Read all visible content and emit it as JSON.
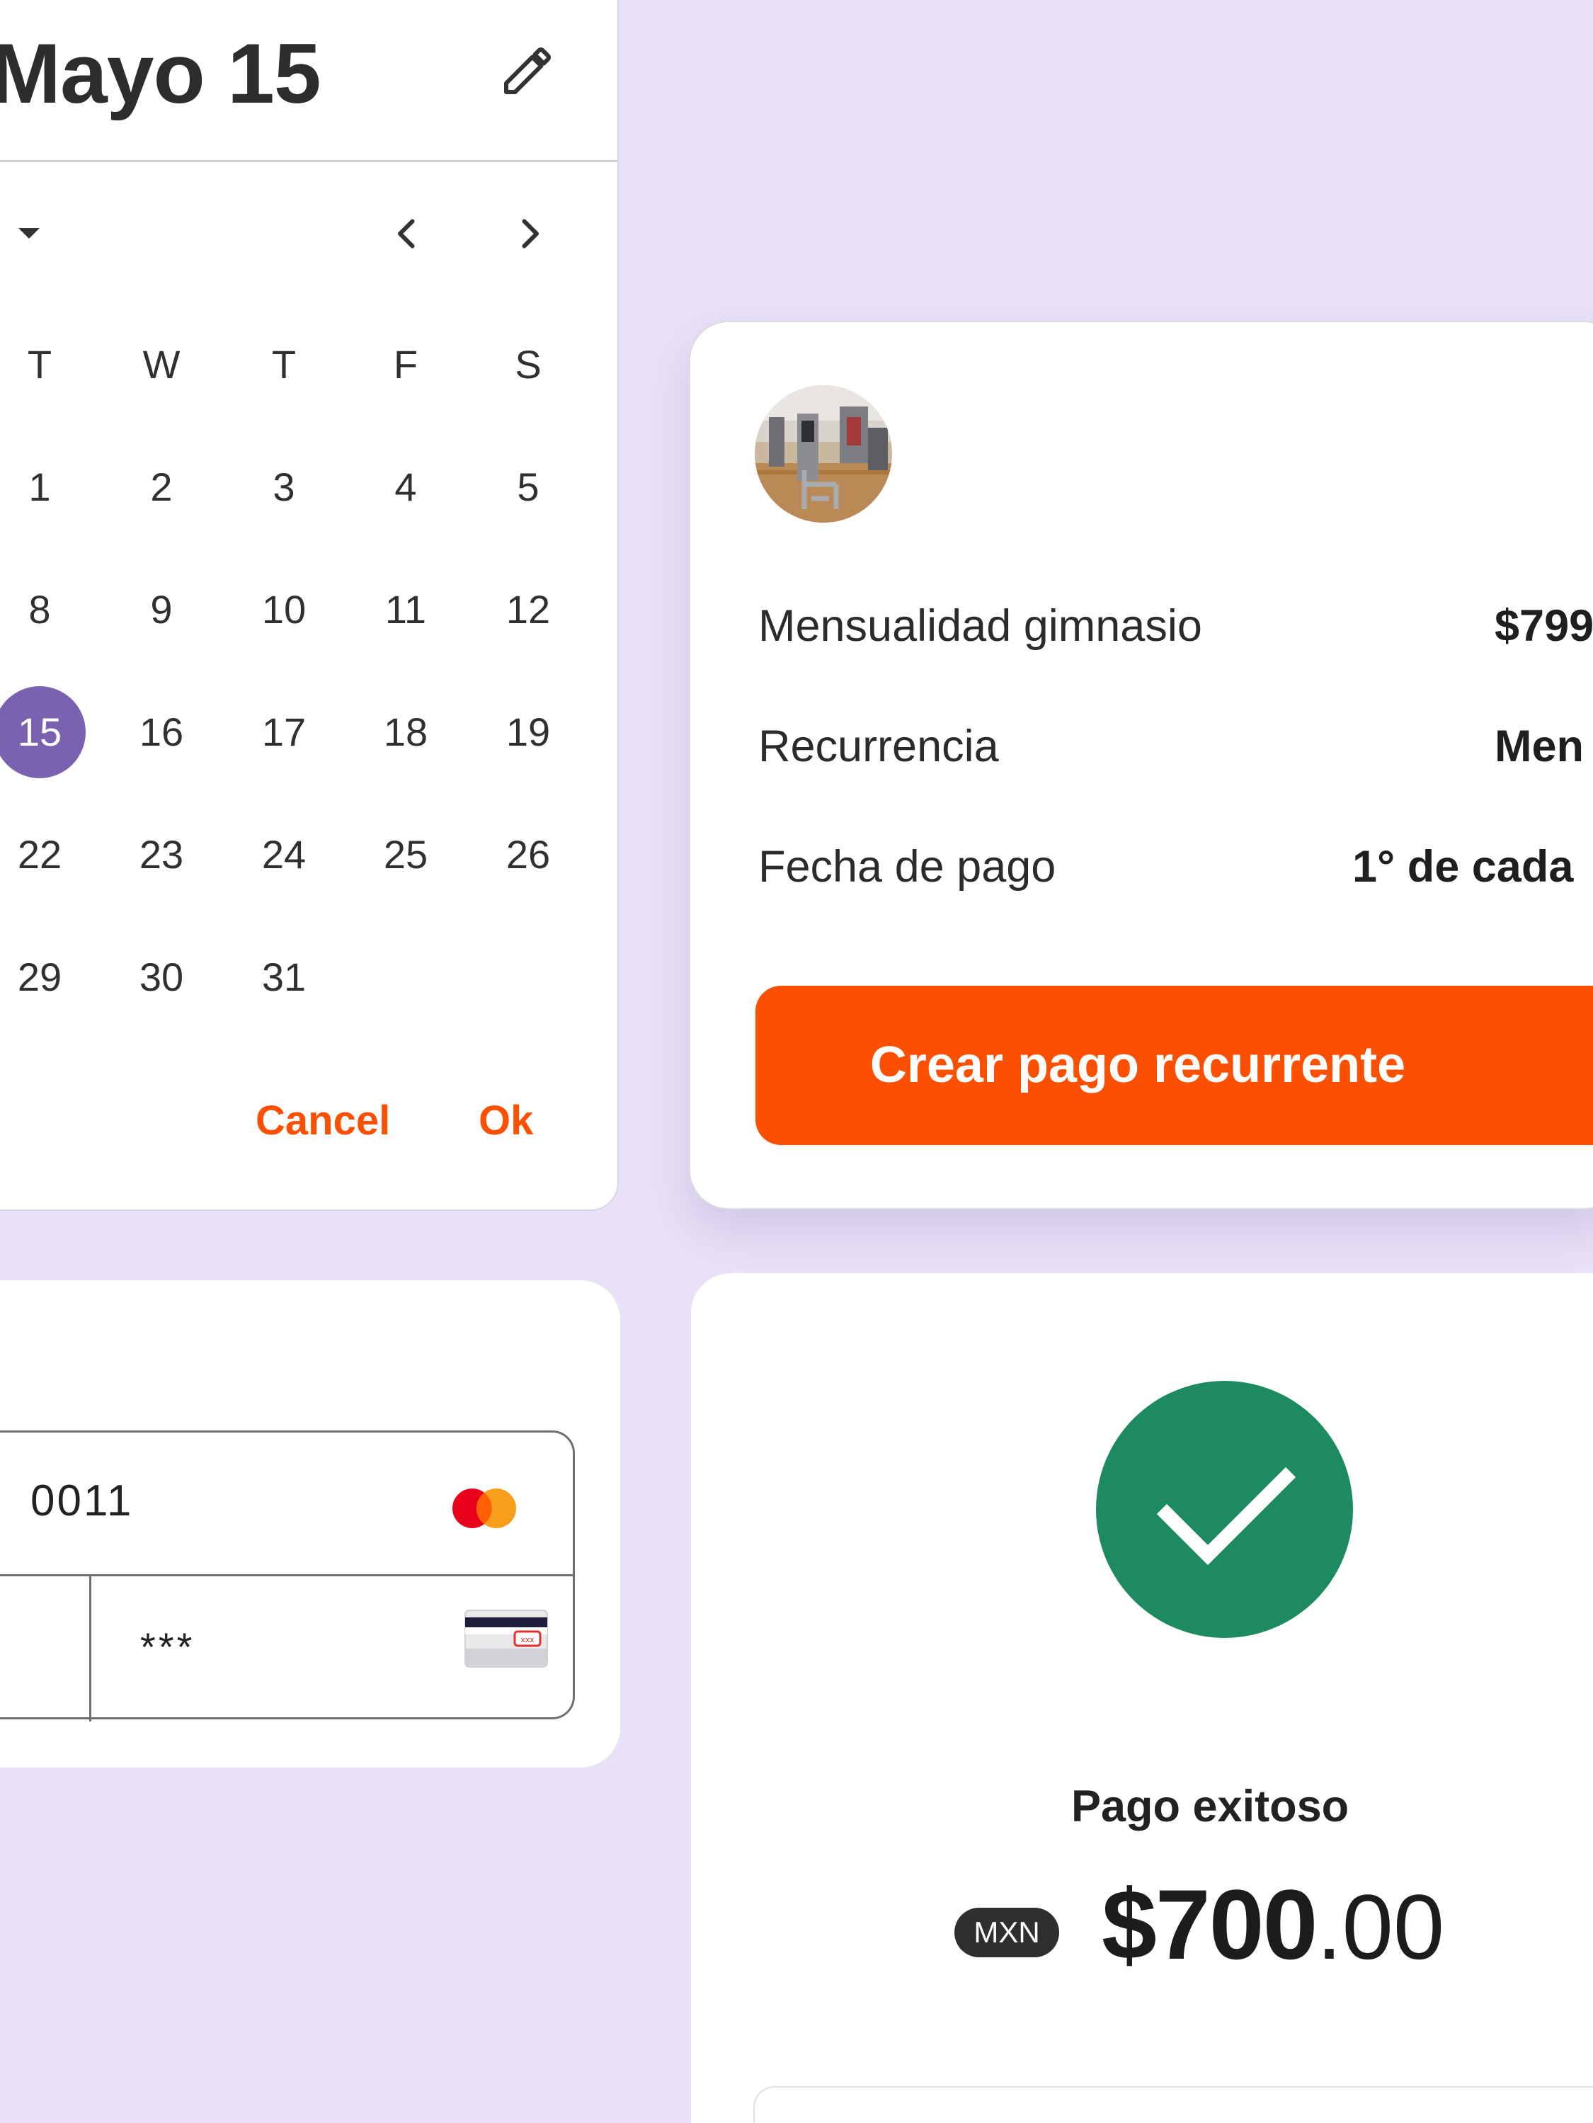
{
  "calendar": {
    "title": "Mayo 15",
    "weekdays": [
      "T",
      "W",
      "T",
      "F",
      "S"
    ],
    "days": [
      [
        "1",
        "2",
        "3",
        "4",
        "5"
      ],
      [
        "8",
        "9",
        "10",
        "11",
        "12"
      ],
      [
        "15",
        "16",
        "17",
        "18",
        "19"
      ],
      [
        "22",
        "23",
        "24",
        "25",
        "26"
      ],
      [
        "29",
        "30",
        "31"
      ]
    ],
    "selected_day": "15",
    "cancel_label": "Cancel",
    "ok_label": "Ok",
    "accent_color": "#fb4f02",
    "selected_color": "#7b62b1"
  },
  "payment": {
    "rows": [
      {
        "label": "Mensualidad gimnasio",
        "value": "$799"
      },
      {
        "label": "Recurrencia",
        "value": "Men"
      },
      {
        "label": "Fecha de pago",
        "value": "1° de cada"
      }
    ],
    "cta_label": "Crear pago recurrente",
    "cta_color": "#fb4f02"
  },
  "card_form": {
    "card_number": "0011",
    "cvv": "***",
    "card_brand_icon": "mastercard-icon",
    "cvv_icon": "card-cvv-icon"
  },
  "success": {
    "title": "Pago exitoso",
    "currency": "MXN",
    "amount_integer": "$700",
    "amount_decimal": ".00",
    "status_color": "#1e8a60"
  }
}
